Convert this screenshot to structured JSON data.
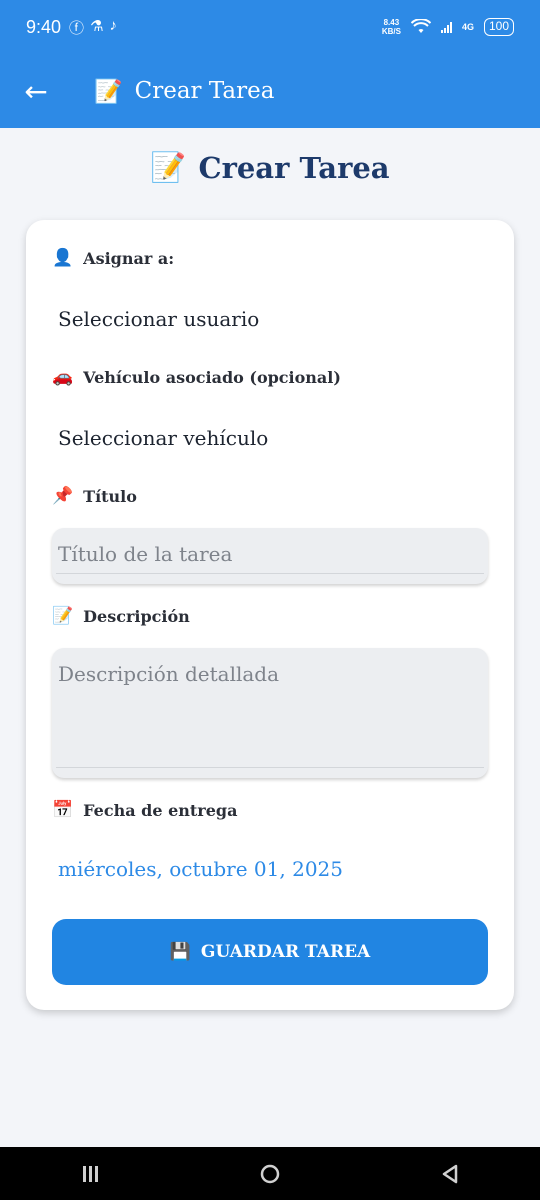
{
  "status_bar": {
    "time": "9:40",
    "speed_value": "8.43",
    "speed_unit": "KB/S",
    "network_label": "4G",
    "battery": "100"
  },
  "app_bar": {
    "title": "Crear Tarea",
    "title_emoji": "📝"
  },
  "page": {
    "heading": "Crear Tarea",
    "heading_emoji": "📝"
  },
  "form": {
    "assign_label": "Asignar a:",
    "assign_emoji": "👤",
    "assign_value": "Seleccionar usuario",
    "vehicle_label": "Vehículo asociado (opcional)",
    "vehicle_emoji": "🚗",
    "vehicle_value": "Seleccionar vehículo",
    "title_label": "Título",
    "title_emoji": "📌",
    "title_placeholder": "Título de la tarea",
    "description_label": "Descripción",
    "description_emoji": "📝",
    "description_placeholder": "Descripción detallada",
    "due_label": "Fecha de entrega",
    "due_emoji": "📅",
    "due_value": "miércoles, octubre 01, 2025",
    "save_label": "GUARDAR TAREA",
    "save_emoji": "💾"
  },
  "colors": {
    "primary": "#2d8ae6",
    "button": "#2185e2",
    "heading": "#1d3a6b"
  }
}
